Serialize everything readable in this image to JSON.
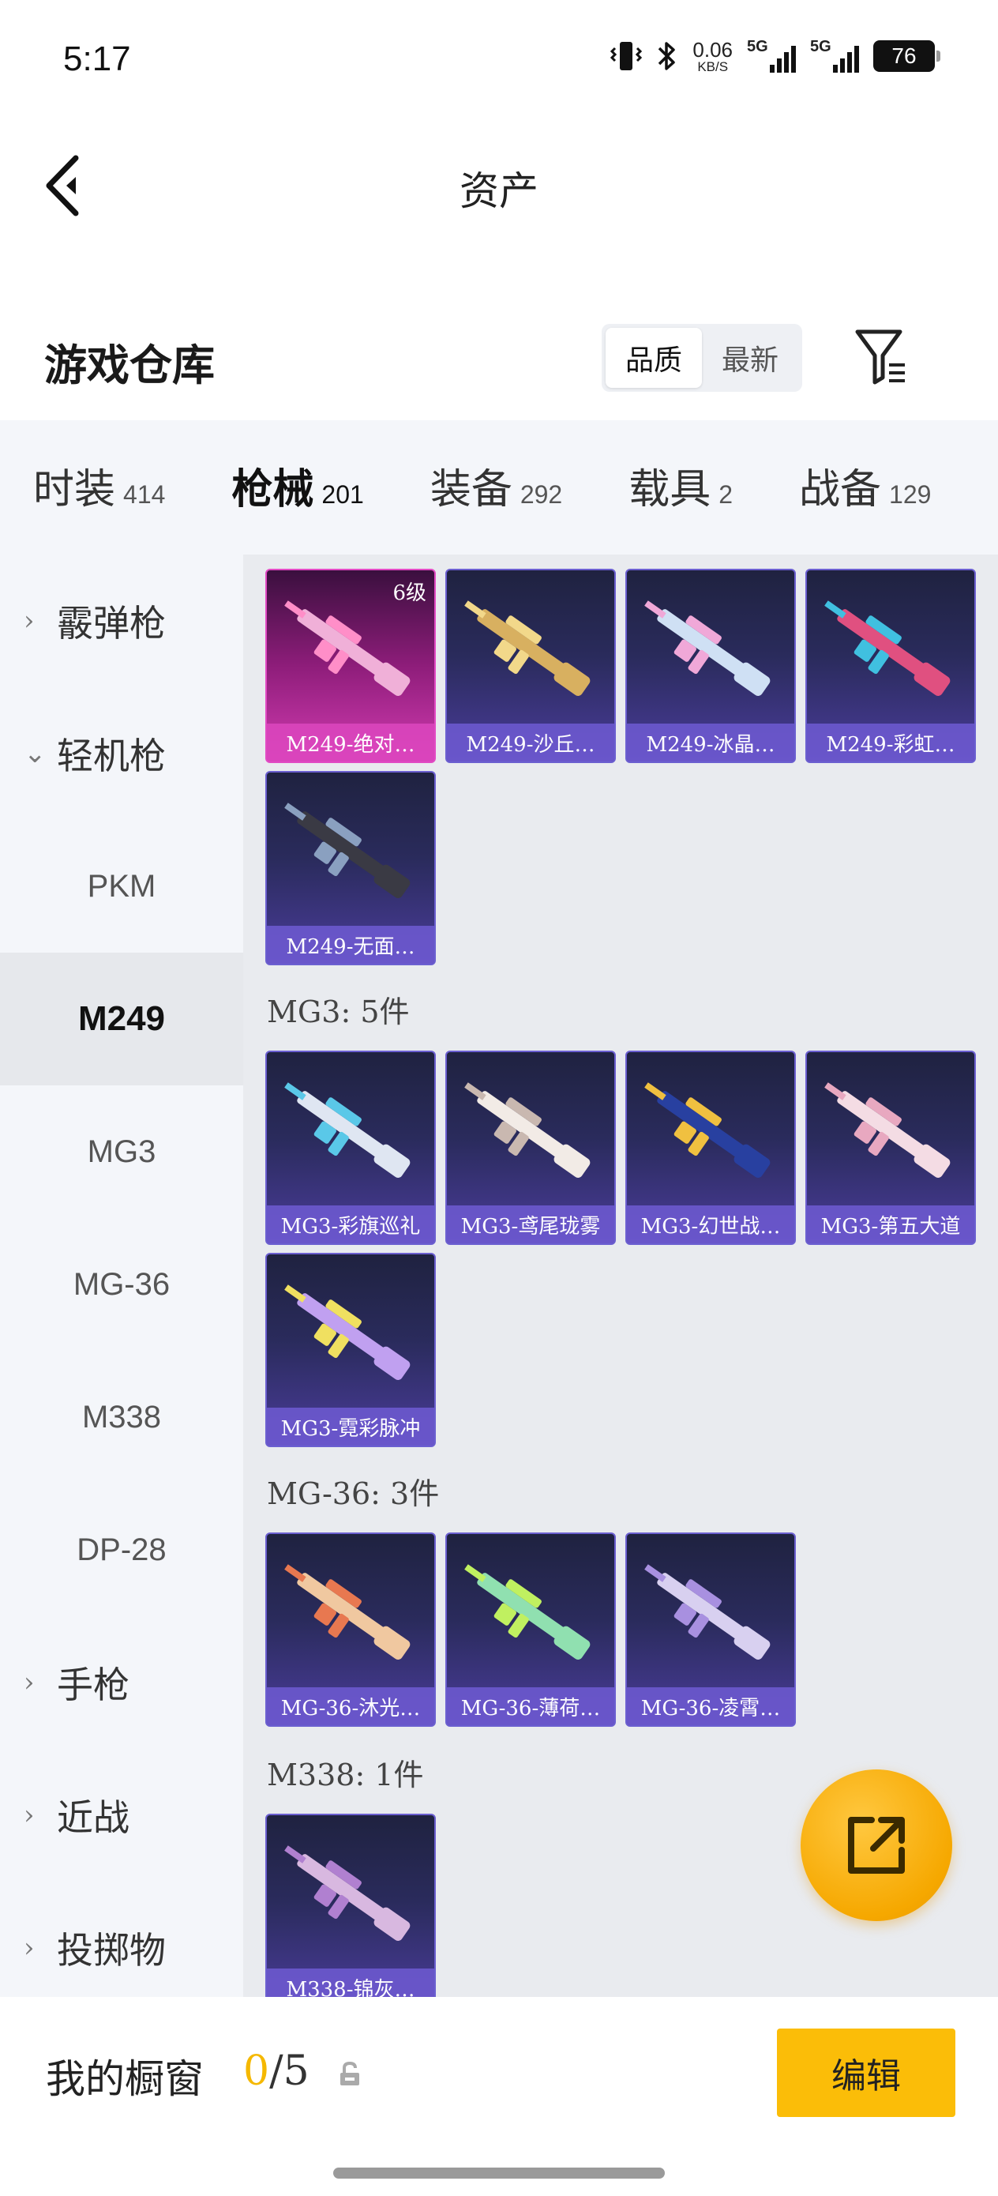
{
  "status_bar": {
    "time": "5:17",
    "speed_value": "0.06",
    "speed_unit": "KB/S",
    "net1_label": "5G",
    "net2_label": "5G",
    "battery": "76"
  },
  "nav": {
    "title": "资产"
  },
  "warehouse": {
    "title": "游戏仓库",
    "sort_options": [
      "品质",
      "最新"
    ],
    "active_sort": "品质"
  },
  "tabs": [
    {
      "label": "时装",
      "count": "414"
    },
    {
      "label": "枪械",
      "count": "201"
    },
    {
      "label": "装备",
      "count": "292"
    },
    {
      "label": "载具",
      "count": "2"
    },
    {
      "label": "战备",
      "count": "129"
    }
  ],
  "active_tab": "枪械",
  "sidebar": {
    "items": [
      {
        "label": "霰弹枪",
        "type": "category",
        "chevron": "›"
      },
      {
        "label": "轻机枪",
        "type": "category",
        "chevron": "⌄"
      },
      {
        "label": "PKM",
        "type": "sub"
      },
      {
        "label": "M249",
        "type": "sub"
      },
      {
        "label": "MG3",
        "type": "sub"
      },
      {
        "label": "MG-36",
        "type": "sub"
      },
      {
        "label": "M338",
        "type": "sub"
      },
      {
        "label": "DP-28",
        "type": "sub"
      },
      {
        "label": "手枪",
        "type": "category",
        "chevron": "›"
      },
      {
        "label": "近战",
        "type": "category",
        "chevron": "›"
      },
      {
        "label": "投掷物",
        "type": "category",
        "chevron": "›"
      }
    ],
    "active_item": "M249"
  },
  "sections": {
    "m249": {
      "items": [
        {
          "name": "M249-绝对…",
          "level": "6级",
          "color": "#f0b0d8",
          "accent": "#ff8ec8"
        },
        {
          "name": "M249-沙丘…",
          "color": "#d8b060",
          "accent": "#f2d88a"
        },
        {
          "name": "M249-冰晶…",
          "color": "#cfe0f4",
          "accent": "#f0a8d8"
        },
        {
          "name": "M249-彩虹…",
          "color": "#e05080",
          "accent": "#40c0e0"
        },
        {
          "name": "M249-无面…",
          "color": "#3a3a44",
          "accent": "#8aa0c0"
        }
      ]
    },
    "mg3": {
      "header": "MG3: 5件",
      "items": [
        {
          "name": "MG3-彩旗巡礼",
          "color": "#dfe6f2",
          "accent": "#5ac8e8"
        },
        {
          "name": "MG3-鸢尾珑雾",
          "color": "#f2ebe6",
          "accent": "#c9b8b0"
        },
        {
          "name": "MG3-幻世战…",
          "color": "#2840a0",
          "accent": "#f0c040"
        },
        {
          "name": "MG3-第五大道",
          "color": "#f4dce4",
          "accent": "#e8a8c0"
        },
        {
          "name": "MG3-霓彩脉冲",
          "color": "#c0a0f0",
          "accent": "#f0e060"
        }
      ]
    },
    "mg36": {
      "header": "MG-36: 3件",
      "items": [
        {
          "name": "MG-36-沐光…",
          "color": "#f0c8a0",
          "accent": "#e87850"
        },
        {
          "name": "MG-36-薄荷…",
          "color": "#90e0b0",
          "accent": "#c0f060"
        },
        {
          "name": "MG-36-凌霄…",
          "color": "#d8d0f0",
          "accent": "#a890e0"
        }
      ]
    },
    "m338": {
      "header": "M338: 1件",
      "items": [
        {
          "name": "M338-锦灰…",
          "color": "#d8b8e0",
          "accent": "#b080d0"
        }
      ]
    }
  },
  "fab": {
    "icon": "share-out-icon"
  },
  "bottom_bar": {
    "title": "我的橱窗",
    "count_current": "0",
    "count_separator": "/5",
    "edit_label": "编辑"
  },
  "colors": {
    "accent_yellow": "#f5b800",
    "card_purple": "#4a3c9a",
    "card_pink": "#d13bb0"
  }
}
